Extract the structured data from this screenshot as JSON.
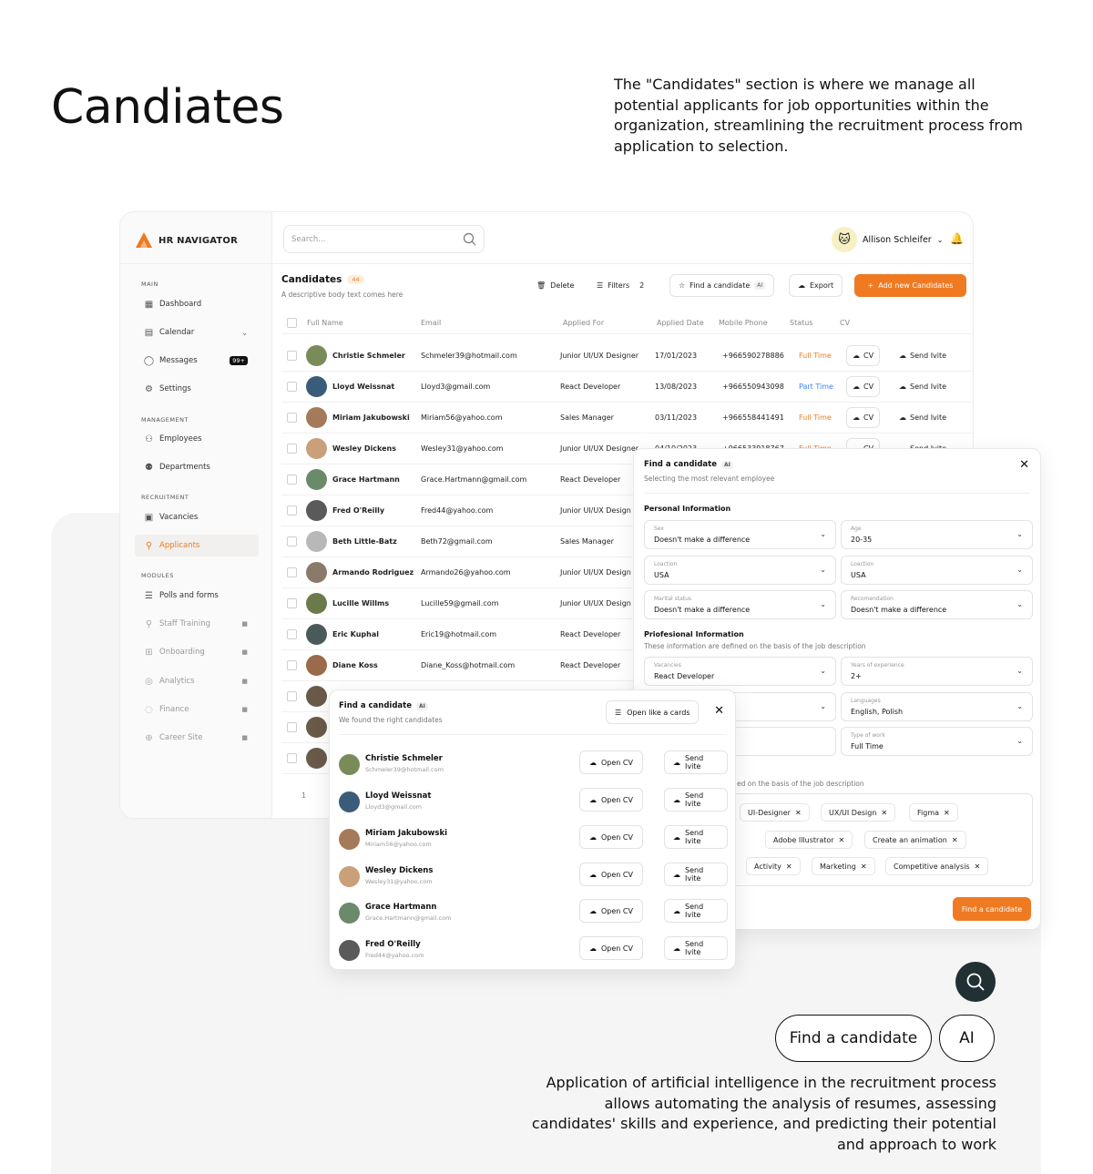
{
  "page": {
    "heading": "Candiates",
    "description": "The \"Candidates\" section is where we manage all potential applicants for job opportunities within the organization, streamlining the recruitment process from application to selection.",
    "bottom_text": "Application of artificial intelligence in the recruitment process allows automating the analysis of resumes, assessing candidates' skills and experience, and predicting their potential and approach to work",
    "pill_find": "Find a candidate",
    "pill_ai": "AI"
  },
  "colors": {
    "accent": "#ef7a22",
    "dark_circle": "#203033",
    "part_time": "#3b82f6"
  },
  "sidebar": {
    "logo": "HR NAVIGATOR",
    "sections": {
      "main": "MAIN",
      "management": "MANAGEMENT",
      "recruitment": "RECRUITMENT",
      "modules": "MODULES"
    },
    "items": {
      "dashboard": "Dashboard",
      "calendar": "Calendar",
      "messages": "Messages",
      "messages_badge": "99+",
      "settings": "Settings",
      "employees": "Employees",
      "departments": "Departments",
      "vacancies": "Vacancies",
      "applicants": "Applicants",
      "polls": "Polls and forms",
      "staff_training": "Staff Training",
      "onboarding": "Onboarding",
      "analytics": "Analytics",
      "finance": "Finance",
      "career": "Career Site"
    }
  },
  "topbar": {
    "search_placeholder": "Search...",
    "user_name": "Allison Schleifer"
  },
  "candidates": {
    "title": "Candidates",
    "count": "44",
    "subtitle": "A descriptive body text comes here",
    "delete": "Delete",
    "filters": "Filters",
    "filters_count": "2",
    "find": "Find a candidate",
    "ai": "AI",
    "export": "Export",
    "add": "Add new Candidates",
    "page": "1"
  },
  "table": {
    "headers": [
      "Full Name",
      "Email",
      "Applied For",
      "Applied Date",
      "Mobile Phone",
      "Status",
      "CV"
    ],
    "cv_label": "CV",
    "invite_label": "Send Ivite",
    "rows": [
      {
        "name": "Christie Schmeler",
        "email": "Schmeler39@hotmail.com",
        "role": "Junior UI/UX Designer",
        "date": "17/01/2023",
        "phone": "+966590278886",
        "status": "Full Time"
      },
      {
        "name": "Lloyd Weissnat",
        "email": "Lloyd3@gmail.com",
        "role": "React Developer",
        "date": "13/08/2023",
        "phone": "+966550943098",
        "status": "Part Time"
      },
      {
        "name": "Miriam Jakubowski",
        "email": "Miriam56@yahoo.com",
        "role": "Sales Manager",
        "date": "03/11/2023",
        "phone": "+966558441491",
        "status": "Full Time"
      },
      {
        "name": "Wesley Dickens",
        "email": "Wesley31@yahoo.com",
        "role": "Junior UI/UX Designer",
        "date": "04/10/2023",
        "phone": "+966533918767",
        "status": "Full Time"
      },
      {
        "name": "Grace Hartmann",
        "email": "Grace.Hartmann@gmail.com",
        "role": "React Developer",
        "date": "",
        "phone": "",
        "status": ""
      },
      {
        "name": "Fred O'Reilly",
        "email": "Fred44@yahoo.com",
        "role": "Junior UI/UX Design",
        "date": "",
        "phone": "",
        "status": ""
      },
      {
        "name": "Beth Little-Batz",
        "email": "Beth72@gmail.com",
        "role": "Sales Manager",
        "date": "",
        "phone": "",
        "status": ""
      },
      {
        "name": "Armando Rodriguez",
        "email": "Armando26@yahoo.com",
        "role": "Junior UI/UX Design",
        "date": "",
        "phone": "",
        "status": ""
      },
      {
        "name": "Lucille Willms",
        "email": "Lucille59@gmail.com",
        "role": "Junior UI/UX Design",
        "date": "",
        "phone": "",
        "status": ""
      },
      {
        "name": "Eric Kuphal",
        "email": "Eric19@hotmail.com",
        "role": "React Developer",
        "date": "",
        "phone": "",
        "status": ""
      },
      {
        "name": "Diane Koss",
        "email": "Diane_Koss@hotmail.com",
        "role": "React Developer",
        "date": "",
        "phone": "",
        "status": ""
      }
    ]
  },
  "filter_panel": {
    "title": "Find a candidate",
    "ai": "AI",
    "subtitle": "Selecting the most relevant employee",
    "personal": "Personal Information",
    "fields": {
      "sex_label": "Sex",
      "sex": "Doesn't make a difference",
      "age_label": "Age",
      "age": "20-35",
      "loc1_label": "Loaction",
      "loc1": "USA",
      "loc2_label": "Loaction",
      "loc2": "USA",
      "marital_label": "Marital status",
      "marital": "Doesn't make a difference",
      "rec_label": "Recomendation",
      "rec": "Doesn't make a difference",
      "vac_label": "Vacancies",
      "vac": "React Developer",
      "exp_label": "Years of experience",
      "exp": "2+",
      "lang_label": "Languages",
      "lang": "English, Polish",
      "work_label": "Type of work",
      "work": "Full Time"
    },
    "professional": "Priofesional Information",
    "professional_sub": "These information are defined on the basis of the job description",
    "skills_sub": "ed on the basis of the job description",
    "tags": [
      "UI-Designer",
      "UX/UI Design",
      "Figma",
      "Adobe Illustrator",
      "Create an animation",
      "Activity",
      "Marketing",
      "Competitive analysis"
    ],
    "find_button": "Find a candidate"
  },
  "results_panel": {
    "title": "Find a candidate",
    "ai": "AI",
    "subtitle": "We found the right candidates",
    "open_cards": "Open like a cards",
    "open_cv": "Open CV",
    "send": "Send Ivite",
    "people": [
      {
        "name": "Christie Schmeler",
        "email": "Schmeler39@hotmail.com"
      },
      {
        "name": "Lloyd Weissnat",
        "email": "Lloyd3@gmail.com"
      },
      {
        "name": "Miriam Jakubowski",
        "email": "Miriam56@yahoo.com"
      },
      {
        "name": "Wesley Dickens",
        "email": "Wesley31@yahoo.com"
      },
      {
        "name": "Grace Hartmann",
        "email": "Grace.Hartmann@gmail.com"
      },
      {
        "name": "Fred O'Reilly",
        "email": "Fred44@yahoo.com"
      }
    ]
  }
}
